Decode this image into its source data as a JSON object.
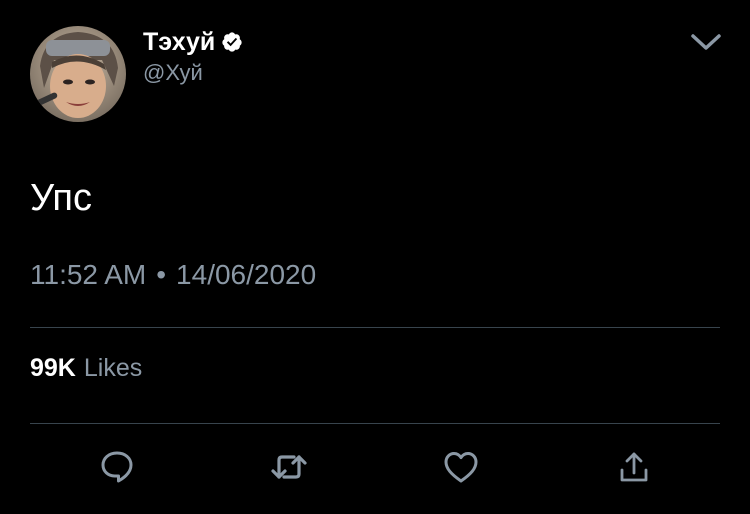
{
  "tweet": {
    "author": {
      "display_name": "Тэхуй",
      "handle": "@Хуй",
      "verified": true
    },
    "text": "Упс",
    "time": "11:52 AM",
    "separator": "•",
    "date": "14/06/2020",
    "likes": {
      "count": "99K",
      "label": "Likes"
    }
  },
  "actions": {
    "reply_icon": "reply-icon",
    "retweet_icon": "retweet-icon",
    "like_icon": "heart-icon",
    "share_icon": "share-icon"
  },
  "colors": {
    "background": "#000000",
    "text_primary": "#ffffff",
    "text_secondary": "#8b98a5",
    "divider": "#38444d",
    "icon": "#8b98a5"
  }
}
